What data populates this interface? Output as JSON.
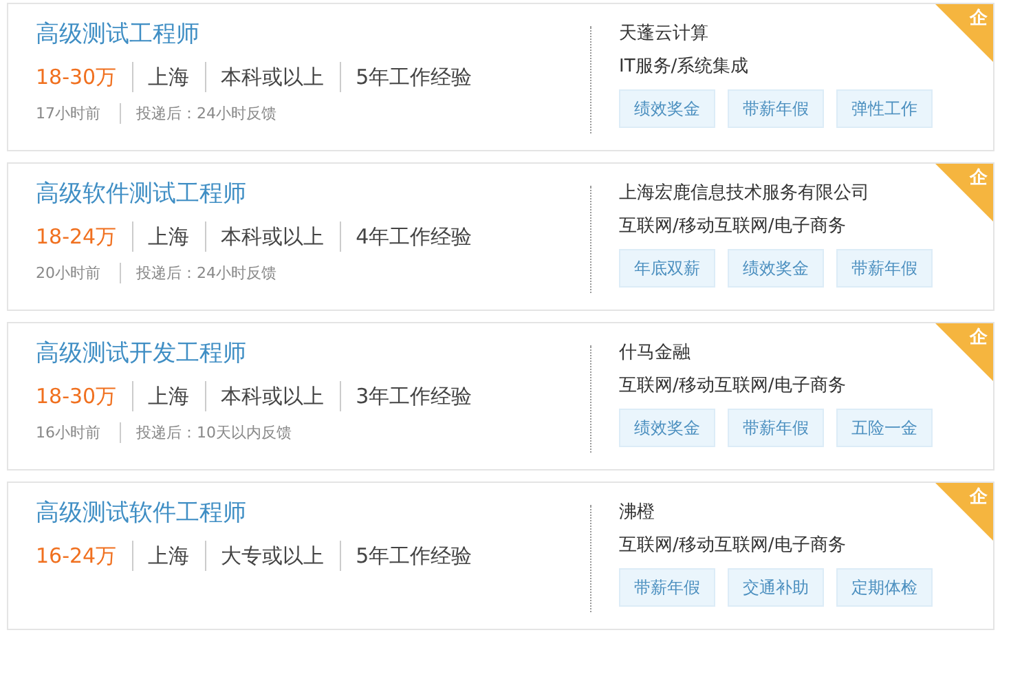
{
  "jobs": [
    {
      "title": "高级测试工程师",
      "salary": "18-30万",
      "city": "上海",
      "education": "本科或以上",
      "experience": "5年工作经验",
      "posted": "17小时前",
      "feedback": "投递后：24小时反馈",
      "company": "天蓬云计算",
      "industry": "IT服务/系统集成",
      "tags": [
        "绩效奖金",
        "带薪年假",
        "弹性工作"
      ],
      "badge": "企"
    },
    {
      "title": "高级软件测试工程师",
      "salary": "18-24万",
      "city": "上海",
      "education": "本科或以上",
      "experience": "4年工作经验",
      "posted": "20小时前",
      "feedback": "投递后：24小时反馈",
      "company": "上海宏鹿信息技术服务有限公司",
      "industry": "互联网/移动互联网/电子商务",
      "tags": [
        "年底双薪",
        "绩效奖金",
        "带薪年假"
      ],
      "badge": "企"
    },
    {
      "title": "高级测试开发工程师",
      "salary": "18-30万",
      "city": "上海",
      "education": "本科或以上",
      "experience": "3年工作经验",
      "posted": "16小时前",
      "feedback": "投递后：10天以内反馈",
      "company": "什马金融",
      "industry": "互联网/移动互联网/电子商务",
      "tags": [
        "绩效奖金",
        "带薪年假",
        "五险一金"
      ],
      "badge": "企"
    },
    {
      "title": "高级测试软件工程师",
      "salary": "16-24万",
      "city": "上海",
      "education": "大专或以上",
      "experience": "5年工作经验",
      "company": "沸橙",
      "industry": "互联网/移动互联网/电子商务",
      "tags": [
        "带薪年假",
        "交通补助",
        "定期体检"
      ],
      "badge": "企"
    }
  ]
}
